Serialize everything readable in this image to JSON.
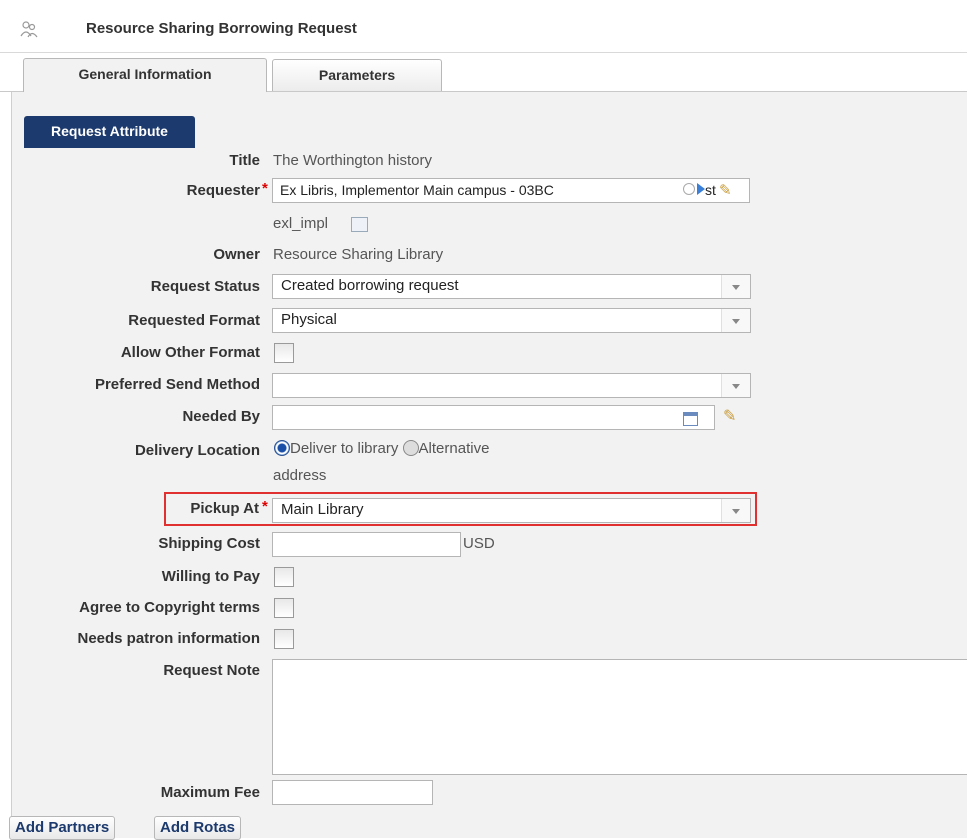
{
  "header": {
    "title": "Resource Sharing Borrowing Request",
    "icon": "people-icon"
  },
  "tabs": [
    {
      "label": "General Information",
      "active": true
    },
    {
      "label": "Parameters",
      "active": false
    }
  ],
  "section": {
    "label": "Request Attribute"
  },
  "fields": {
    "title": {
      "label": "Title",
      "value": "The Worthington history"
    },
    "requester": {
      "label": "Requester",
      "required": "*",
      "value": "Ex Libris, Implementor Main campus  - 03BC",
      "suffix": "st",
      "sub_value": "exl_impl"
    },
    "owner": {
      "label": "Owner",
      "value": "Resource Sharing Library"
    },
    "request_status": {
      "label": "Request Status",
      "value": "Created borrowing request"
    },
    "requested_format": {
      "label": "Requested Format",
      "value": "Physical"
    },
    "allow_other_format": {
      "label": "Allow Other Format",
      "checked": false
    },
    "preferred_send_method": {
      "label": "Preferred Send Method",
      "value": ""
    },
    "needed_by": {
      "label": "Needed By",
      "value": ""
    },
    "delivery_location": {
      "label": "Delivery Location",
      "option1": "Deliver to library",
      "option2": "Alternative",
      "option2_line2": "address",
      "selected": "Deliver to library"
    },
    "pickup_at": {
      "label": "Pickup At",
      "required": "*",
      "value": "Main Library"
    },
    "shipping_cost": {
      "label": "Shipping Cost",
      "value": "",
      "currency": "USD"
    },
    "willing_to_pay": {
      "label": "Willing to Pay",
      "checked": false
    },
    "agree_copyright": {
      "label": "Agree to Copyright terms",
      "checked": false
    },
    "needs_patron_info": {
      "label": "Needs patron information",
      "checked": false
    },
    "request_note": {
      "label": "Request Note",
      "value": ""
    },
    "maximum_fee": {
      "label": "Maximum Fee",
      "value": ""
    }
  },
  "buttons": {
    "add_partners": "Add Partners",
    "add_rotas": "Add Rotas"
  },
  "colors": {
    "accent": "#1c3a6d",
    "highlight": "#e03030",
    "required": "#dd0000"
  }
}
